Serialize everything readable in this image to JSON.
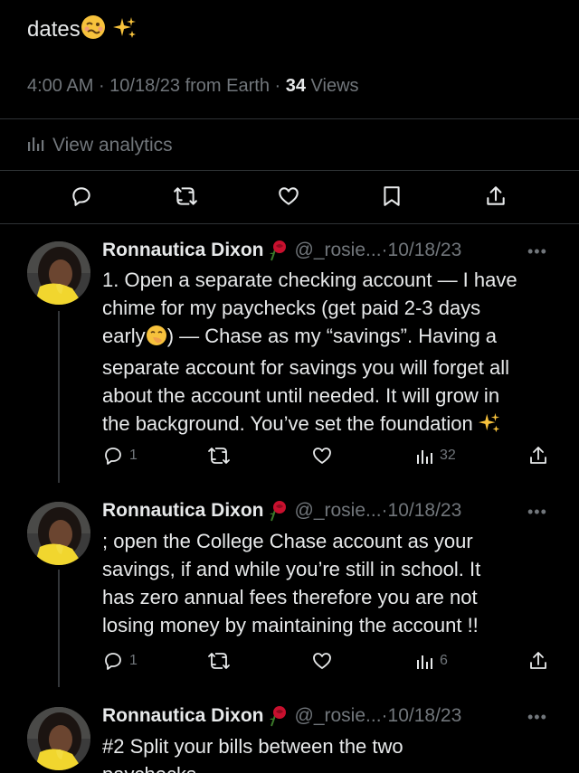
{
  "main_tweet": {
    "text_tail": "dates",
    "time": "4:00 AM",
    "date": "10/18/23",
    "source": "from Earth",
    "views_count": "34",
    "views_label": "Views",
    "analytics_label": "View analytics"
  },
  "replies": [
    {
      "name": "Ronnautica Dixon",
      "handle": "@_rosie...",
      "date": "10/18/23",
      "lines": [
        "1. Open a separate checking account — I have",
        "chime for my paychecks (get paid 2-3 days",
        "early",
        ") — Chase as my “savings”.  Having a",
        "separate account for savings you will forget all",
        "about the account until needed. It will grow in",
        "the background. You’ve set the foundation"
      ],
      "reply_count": "1",
      "view_count": "32"
    },
    {
      "name": "Ronnautica Dixon",
      "handle": "@_rosie...",
      "date": "10/18/23",
      "lines": [
        "; open the College Chase account as your",
        "savings, if and while you’re still in school. It",
        "has zero annual fees therefore you are not",
        "losing money by maintaining the account !!"
      ],
      "reply_count": "1",
      "view_count": "6"
    },
    {
      "name": "Ronnautica Dixon",
      "handle": "@_rosie...",
      "date": "10/18/23",
      "lines": [
        "#2 Split your bills between the two",
        "paychecks"
      ]
    }
  ],
  "colors": {
    "bg": "#000000",
    "text": "#e7e9ea",
    "muted": "#71767b",
    "divider": "#2f3336"
  },
  "icons": [
    "reply-icon",
    "retweet-icon",
    "like-icon",
    "bookmark-icon",
    "share-icon",
    "analytics-icon",
    "rose-emoji",
    "sparkles-emoji",
    "woozy-face-emoji",
    "hand-over-mouth-emoji",
    "more-icon"
  ]
}
